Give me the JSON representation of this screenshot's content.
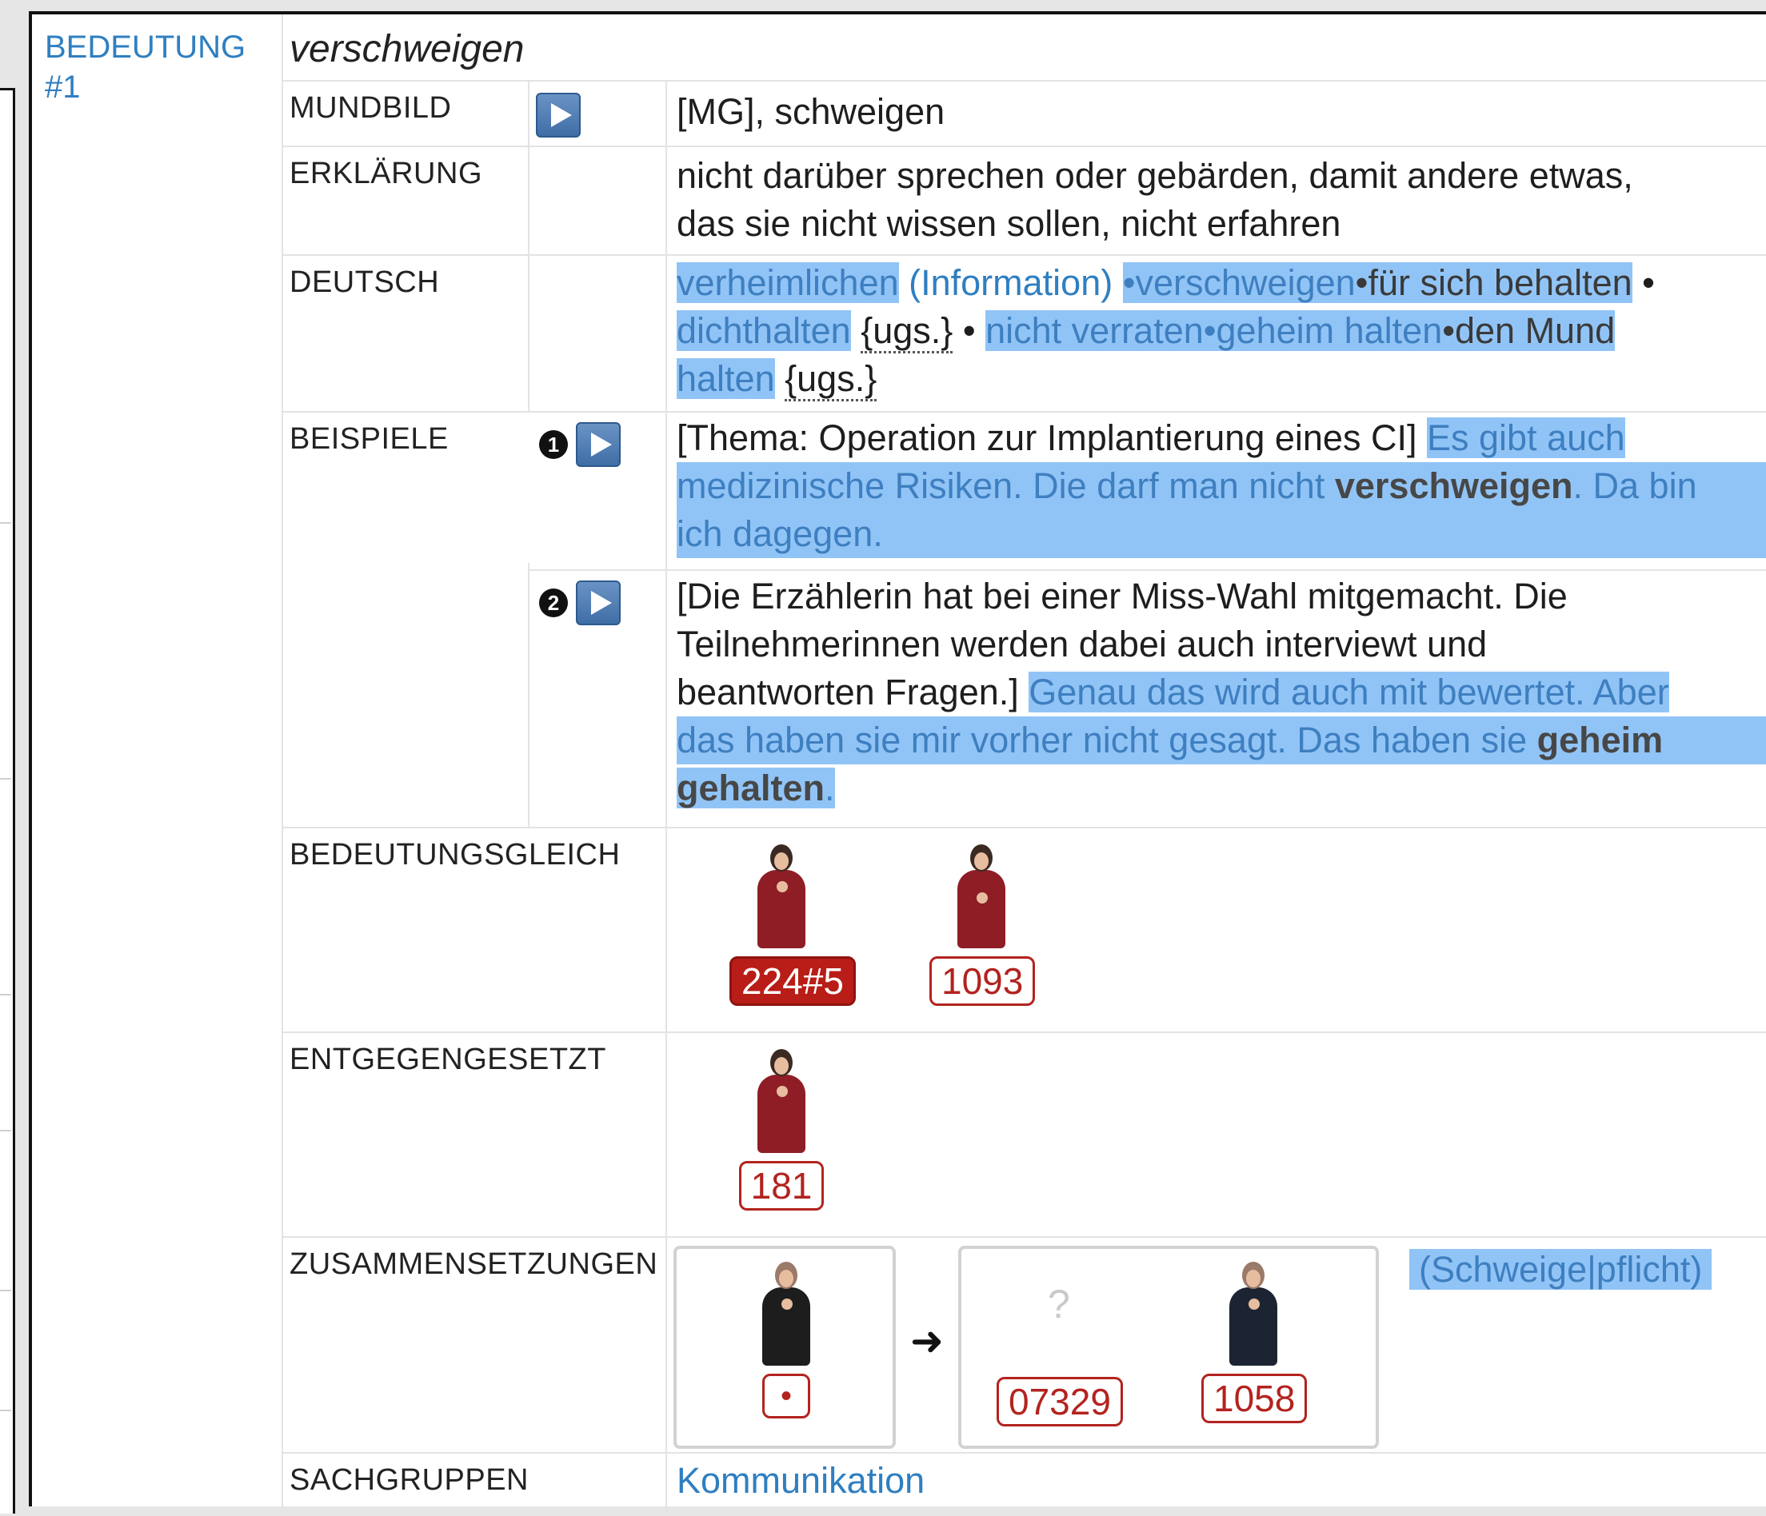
{
  "meaning": {
    "label_line1": "BEDEUTUNG",
    "label_line2": "#1",
    "word": "verschweigen"
  },
  "rows": {
    "mundbild": {
      "label": "MUNDBILD",
      "value": "[MG], schweigen"
    },
    "erklaerung": {
      "label": "ERKLÄRUNG",
      "line1": "nicht darüber sprechen oder gebärden, damit andere etwas,",
      "line2": "das sie nicht wissen sollen, nicht erfahren"
    },
    "deutsch": {
      "label": "DEUTSCH",
      "terms": [
        "verheimlichen",
        "(Information)",
        "•",
        "verschweigen",
        "•",
        "für sich behalten",
        "•",
        "dichthalten",
        "{ugs.}",
        "•",
        "nicht verraten",
        "•",
        "geheim halten",
        "•",
        "den Mund",
        "halten",
        "{ugs.}"
      ]
    },
    "beispiele": {
      "label": "BEISPIELE",
      "ex1": {
        "num": "1",
        "context": "[Thema: Operation zur Implantierung eines CI]",
        "text_a": "Es gibt auch",
        "text_b": "medizinische Risiken. Die darf man nicht",
        "bold": "verschweigen",
        "text_c": ". Da bin",
        "text_d": "ich dagegen."
      },
      "ex2": {
        "num": "2",
        "context1": "[Die Erzählerin hat bei einer Miss-Wahl mitgemacht. Die",
        "context2": "Teilnehmerinnen werden dabei auch interviewt und",
        "context3": "beantworten Fragen.]",
        "text_a": "Genau das wird auch mit bewertet. Aber",
        "text_b": "das haben sie mir vorher nicht gesagt. Das haben sie",
        "bold1": "geheim",
        "bold2": "gehalten",
        "text_c": "."
      }
    },
    "bedeutungsgleich": {
      "label": "BEDEUTUNGSGLEICH",
      "signs": [
        "224#5",
        "1093"
      ]
    },
    "entgegengesetzt": {
      "label": "ENTGEGENGESETZT",
      "signs": [
        "181"
      ]
    },
    "zusammensetzungen": {
      "label": "ZUSAMMENSETZUNGEN",
      "first_sign": "•",
      "arrow": "➜",
      "question": "?",
      "signs": [
        "07329",
        "1058"
      ],
      "compound": "(Schweige|pflicht)"
    },
    "sachgruppen": {
      "label": "SACHGRUPPEN",
      "value": "Kommunikation"
    }
  },
  "colors": {
    "highlight": "#91c4f6",
    "link": "#2f7fc1",
    "badge": "#b3231f"
  }
}
